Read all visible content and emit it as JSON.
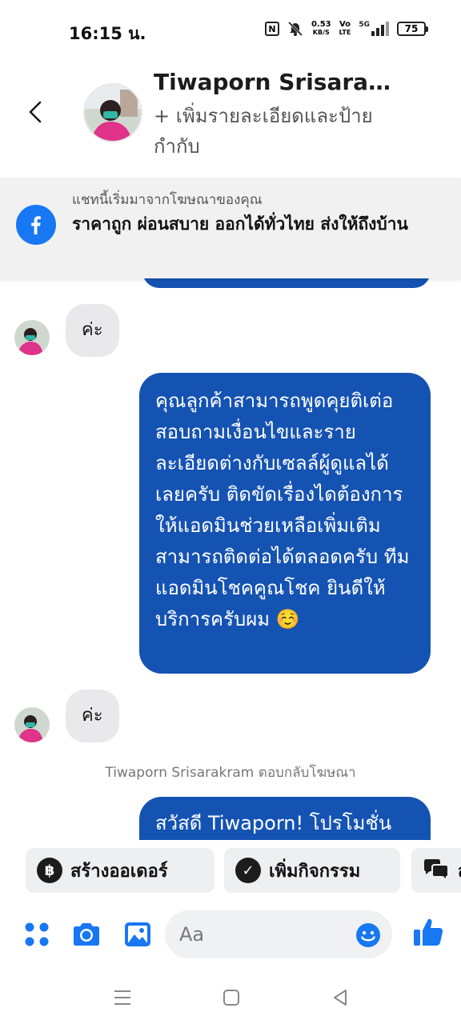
{
  "status_bar": {
    "time": "16:15 น.",
    "speed_value": "0.53",
    "speed_unit": "KB/S",
    "volte_top": "Vo",
    "volte_bottom": "LTE",
    "network": "5G",
    "battery": "75"
  },
  "header": {
    "contact_name": "Tiwaporn Srisara…",
    "add_details": "+ เพิ่มรายละเอียดและป้ายกำกับ"
  },
  "ad_banner": {
    "label": "แชทนี้เริ่มมาจากโฆษณาของคุณ",
    "title": "ราคาถูก ผ่อนสบาย ออกได้ทั่วไทย ส่งให้ถึงบ้าน"
  },
  "messages": {
    "reply_1": "ค่ะ",
    "outgoing_1": "คุณลูกค้าสามารถพูดคุยติเต่อสอบถามเงื่อนไขและรายละเอียดต่างกับเซลล์ผู้ดูแลได้เลยครับ ติดขัดเรื่องไดต้องการให้แอดมินช่วยเหลือเพิ่มเติมสามารถติดต่อได้ตลอดครับ ทีมแอดมินโชคคูณโชค ยินดีให้บริการครับผม ☺️",
    "reply_2": "ค่ะ",
    "system_note": "Tiwaporn Srisarakram ตอบกลับโฆษณา",
    "outgoing_2": "สวัสดี Tiwaporn! โปรโมชั่น"
  },
  "quick_actions": [
    {
      "label": "สร้างออเดอร์",
      "icon": "฿"
    },
    {
      "label": "เพิ่มกิจกรรม",
      "icon": "✓"
    },
    {
      "label": "ส",
      "icon": "chat"
    }
  ],
  "composer": {
    "placeholder": "Aa"
  },
  "colors": {
    "messenger_blue": "#1877f2",
    "outgoing_bubble": "#1553b3",
    "incoming_bubble": "#e9e9eb"
  }
}
